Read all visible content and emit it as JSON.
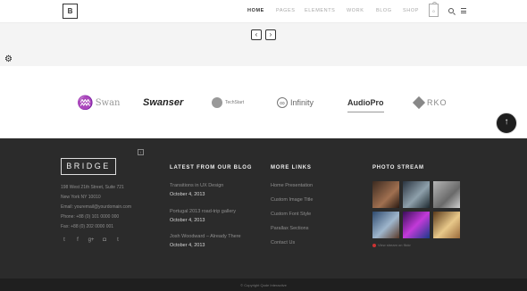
{
  "header": {
    "logo_letter": "B",
    "nav": [
      "HOME",
      "PAGES",
      "ELEMENTS",
      "WORK",
      "BLOG",
      "SHOP"
    ],
    "active_nav": "HOME",
    "cart_count": "0",
    "search_icon": "search-icon",
    "menu_icon": "hamburger-menu-icon"
  },
  "slider": {
    "prev_label": "‹",
    "next_label": "›"
  },
  "settings_icon": "gear-icon",
  "clients": {
    "swan": "Swan",
    "swanser": "Swanser",
    "techstart": "TechStart",
    "infinity": "Infinity",
    "audiopro": "AudioPro",
    "rko": "RKO"
  },
  "footer": {
    "logo_text": "BRIDGE",
    "address": [
      "198 West 21th Street, Suite 721",
      "New York NY 10010",
      "Email: youremail@yourdomain.com",
      "Phone: +88 (0) 101 0000 000",
      "Fax: +88 (0) 202 0000 001"
    ],
    "social_icons": [
      "twitter-icon",
      "facebook-icon",
      "google-plus-icon",
      "instagram-icon",
      "tumblr-icon"
    ],
    "blog": {
      "title": "LATEST FROM OUR BLOG",
      "posts": [
        {
          "title": "Transitions in UX Design",
          "date": "October 4, 2013"
        },
        {
          "title": "Portugal 2013 road-trip gallery",
          "date": "October 4, 2013"
        },
        {
          "title": "Josh Woodward – Already There",
          "date": "October 4, 2013"
        }
      ]
    },
    "more_links": {
      "title": "MORE LINKS",
      "items": [
        "Home Presentation",
        "Custom Image Title",
        "Custom Font Style",
        "Parallax Sections",
        "Contact Us"
      ]
    },
    "photo_stream": {
      "title": "PHOTO STREAM",
      "link_text": "View stream on flickr",
      "photo_colors": [
        "#6b4a3a",
        "#4f6270",
        "#8a8a8a",
        "#3a5f8c",
        "#7a2a8c",
        "#c9a86a"
      ]
    },
    "copyright": "© Copyright Qode Interactive"
  },
  "scroll_top_label": "↑"
}
